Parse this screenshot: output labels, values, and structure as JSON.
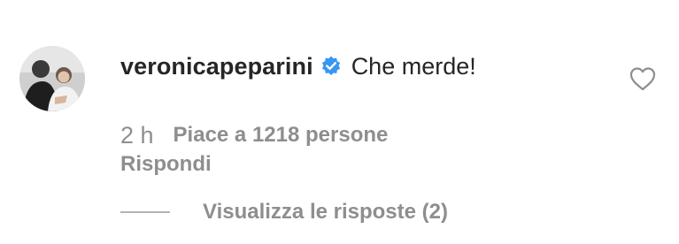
{
  "comment": {
    "avatar_icon": "profile-photo",
    "username": "veronicapeparini",
    "verified_icon": "verified-badge-icon",
    "verified_color": "#3897f0",
    "text": "Che merde!",
    "like_icon": "heart-outline-icon",
    "time": "2 h",
    "likes_text": "Piace a 1218 persone",
    "reply_label": "Rispondi",
    "view_replies_label": "Visualizza le risposte (2)"
  },
  "colors": {
    "primary_text": "#262626",
    "secondary_text": "#8e8e8e",
    "background": "#ffffff"
  }
}
